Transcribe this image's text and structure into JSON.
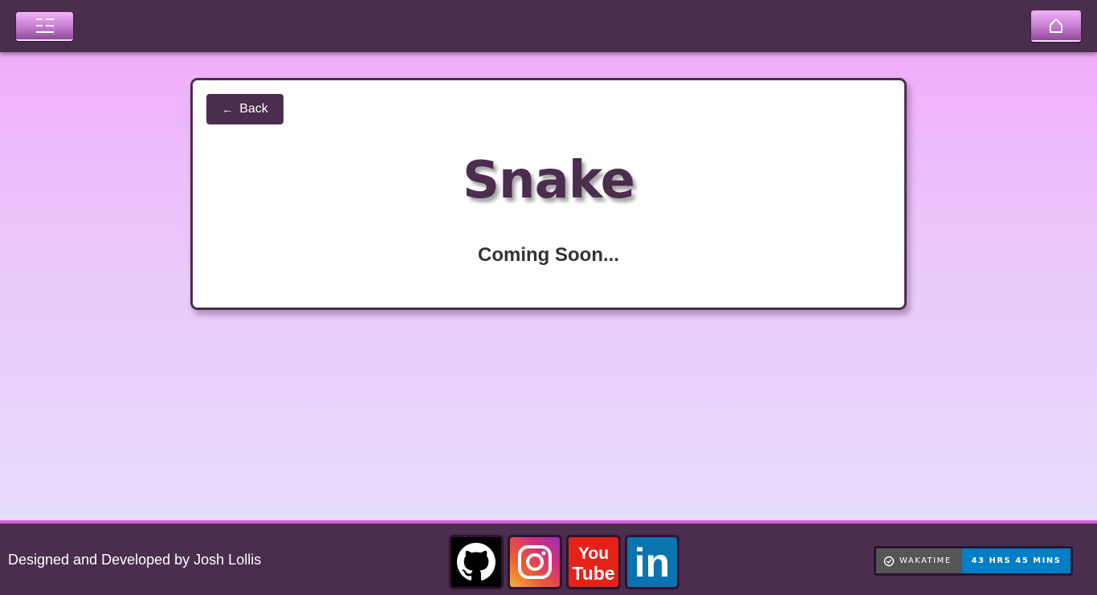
{
  "header": {
    "menu_icon": "menu-icon",
    "home_icon": "home-icon"
  },
  "card": {
    "back_arrow": "←",
    "back_label": "Back",
    "title": "Snake",
    "subtitle": "Coming Soon..."
  },
  "footer": {
    "credit": "Designed and Developed by Josh Lollis",
    "socials": [
      {
        "name": "GitHub",
        "icon": "github-icon"
      },
      {
        "name": "Instagram",
        "icon": "instagram-icon"
      },
      {
        "name": "YouTube",
        "icon": "youtube-icon",
        "text_top": "You",
        "text_bottom": "Tube"
      },
      {
        "name": "LinkedIn",
        "icon": "linkedin-icon",
        "text": "in"
      }
    ],
    "badge": {
      "label": "WAKATIME",
      "value": "43 HRS 45 MINS"
    }
  },
  "colors": {
    "primary": "#4b2d4d",
    "accent": "#d25fe0",
    "badge_value_bg": "#007ec6"
  }
}
